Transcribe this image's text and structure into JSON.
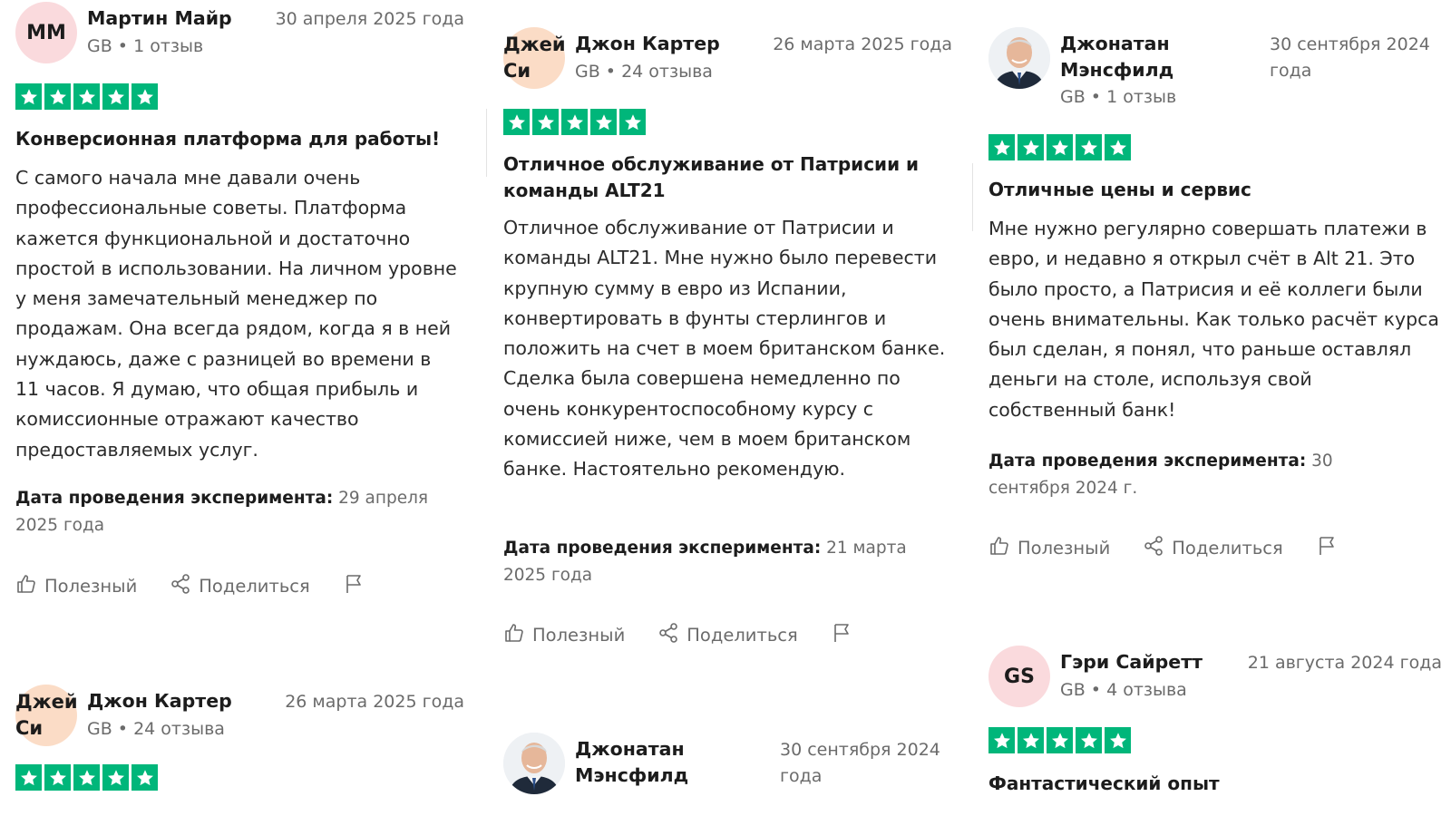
{
  "colors": {
    "star_green": "#00b67a",
    "meta_gray": "#6b6b6b",
    "avatar_pink": "#fadadd",
    "avatar_peach": "#fbdcc6"
  },
  "rating_max": 5,
  "icons": [
    "star-icon",
    "thumbs-up-icon",
    "share-icon",
    "flag-icon"
  ],
  "actions": {
    "helpful": "Полезный",
    "share": "Поделиться"
  },
  "exp_label": "Дата проведения эксперимента:",
  "reviews": {
    "martin": {
      "initials": "ММ",
      "name": "Мартин Майр",
      "country": "GB",
      "count": "1 отзыв",
      "date": "30 апреля 2025 года",
      "rating": 5,
      "title": "Конверсионная платформа для работы!",
      "body": "С самого начала мне давали очень профессиональные советы. Платформа кажется функциональной и достаточно простой в использовании. На личном уровне у меня замечательный менеджер по продажам. Она всегда рядом, когда я в ней нуждаюсь, даже с разницей во времени в 11 часов. Я думаю, что общая прибыль и комиссионные отражают качество предоставляемых услуг.",
      "exp_date": "29 апреля 2025 года"
    },
    "john_c1": {
      "initials": "Джей Си",
      "name": "Джон Картер",
      "country": "GB",
      "count": "24 отзыва",
      "date": "26 марта 2025 года",
      "rating": 5
    },
    "john_c2": {
      "initials": "Джей Си",
      "name": "Джон Картер",
      "country": "GB",
      "count": "24 отзыва",
      "date": "26 марта 2025 года",
      "rating": 5,
      "title": "Отличное обслуживание от Патрисии и команды ALT21",
      "body": "Отличное обслуживание от Патрисии и команды ALT21. Мне нужно было перевести крупную сумму в евро из Испании, конвертировать в фунты стерлингов и положить на счет в моем британском банке. Сделка была совершена немедленно по очень конкурентоспособному курсу с комиссией ниже, чем в моем британском банке. Настоятельно рекомендую.",
      "exp_date": "21 марта 2025 года"
    },
    "jonathan1": {
      "name": "Джонатан Мэнсфилд",
      "country": "GB",
      "count": "1 отзыв",
      "date": "30 сентября 2024 года",
      "rating": 5,
      "title": "Отличные цены и сервис",
      "body": "Мне нужно регулярно совершать платежи в евро, и недавно я открыл счёт в Alt 21. Это было просто, а Патрисия и её коллеги были очень внимательны. Как только расчёт курса был сделан, я понял, что раньше оставлял деньги на столе, используя свой собственный банк!",
      "exp_date": "30 сентября 2024 г."
    },
    "jonathan2": {
      "name": "Джонатан Мэнсфилд",
      "date": "30 сентября 2024 года"
    },
    "gary": {
      "initials": "GS",
      "name": "Гэри Сайретт",
      "country": "GB",
      "count": "4 отзыва",
      "date": "21 августа 2024 года",
      "rating": 5,
      "title": "Фантастический опыт"
    }
  }
}
